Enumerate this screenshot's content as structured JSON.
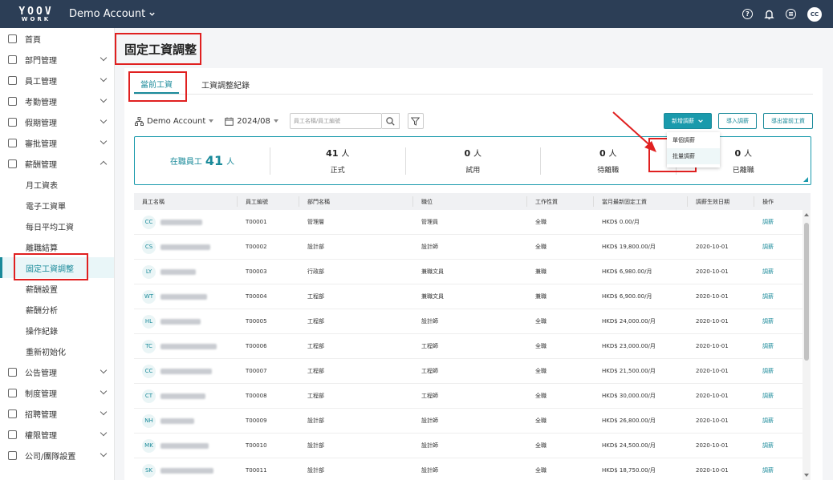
{
  "brand": {
    "line1": "YOOV",
    "line2": "WORK"
  },
  "account": "Demo Account",
  "user_initials": "CC",
  "sidebar": {
    "items": [
      {
        "label": "首頁",
        "icon": "dashboard-icon",
        "chevron": false
      },
      {
        "label": "部門管理",
        "icon": "org-icon",
        "chevron": true
      },
      {
        "label": "員工管理",
        "icon": "users-icon",
        "chevron": true
      },
      {
        "label": "考勤管理",
        "icon": "calendar-icon",
        "chevron": true
      },
      {
        "label": "假期管理",
        "icon": "beach-icon",
        "chevron": true
      },
      {
        "label": "審批管理",
        "icon": "stamp-icon",
        "chevron": true
      },
      {
        "label": "薪酬管理",
        "icon": "dollar-icon",
        "chevron": true,
        "open": true
      }
    ],
    "sub_items": [
      "月工資表",
      "電子工資單",
      "每日平均工資",
      "離職結算",
      "固定工資調整",
      "薪酬設置",
      "薪酬分析",
      "操作紀錄",
      "重新初始化"
    ],
    "items_after": [
      {
        "label": "公告管理",
        "icon": "megaphone-icon"
      },
      {
        "label": "制度管理",
        "icon": "book-icon"
      },
      {
        "label": "招聘管理",
        "icon": "briefcase-icon"
      },
      {
        "label": "權限管理",
        "icon": "shield-icon"
      },
      {
        "label": "公司/團隊設置",
        "icon": "building-icon"
      }
    ]
  },
  "page_title": "固定工資調整",
  "tabs": [
    "當前工資",
    "工資調整紀錄"
  ],
  "filters": {
    "department": "Demo Account",
    "month": "2024/08",
    "search_placeholder": "員工名稱/員工編號"
  },
  "buttons": {
    "new_adjust": "新增調薪",
    "import": "導入調薪",
    "export": "導出當前工資"
  },
  "dropdown": [
    "單個調薪",
    "批量調薪"
  ],
  "stats": {
    "active_label": "在職員工",
    "active_count": "41",
    "active_unit": "人",
    "items": [
      {
        "count": "41",
        "unit": "人",
        "label": "正式"
      },
      {
        "count": "0",
        "unit": "人",
        "label": "試用"
      },
      {
        "count": "0",
        "unit": "人",
        "label": "待離職"
      },
      {
        "count": "0",
        "unit": "人",
        "label": "已離職"
      }
    ]
  },
  "table": {
    "headers": [
      "員工名稱",
      "員工編號",
      "部門名稱",
      "職位",
      "工作性質",
      "當月最新固定工資",
      "調薪生效日期",
      "操作"
    ],
    "rows": [
      {
        "initials": "CC",
        "id": "T00001",
        "dept": "管理層",
        "pos": "管理員",
        "type": "全職",
        "salary": "HKD$ 0.00/月",
        "date": "",
        "action": "調薪"
      },
      {
        "initials": "CS",
        "id": "T00002",
        "dept": "設計部",
        "pos": "設計師",
        "type": "全職",
        "salary": "HKD$ 19,800.00/月",
        "date": "2020-10-01",
        "action": "調薪"
      },
      {
        "initials": "LY",
        "id": "T00003",
        "dept": "行政部",
        "pos": "兼職文員",
        "type": "兼職",
        "salary": "HKD$ 6,980.00/月",
        "date": "2020-10-01",
        "action": "調薪"
      },
      {
        "initials": "WT",
        "id": "T00004",
        "dept": "工程部",
        "pos": "兼職文員",
        "type": "兼職",
        "salary": "HKD$ 6,900.00/月",
        "date": "2020-10-01",
        "action": "調薪"
      },
      {
        "initials": "HL",
        "id": "T00005",
        "dept": "工程部",
        "pos": "設計師",
        "type": "全職",
        "salary": "HKD$ 24,000.00/月",
        "date": "2020-10-01",
        "action": "調薪"
      },
      {
        "initials": "TC",
        "id": "T00006",
        "dept": "工程部",
        "pos": "工程師",
        "type": "全職",
        "salary": "HKD$ 23,000.00/月",
        "date": "2020-10-01",
        "action": "調薪"
      },
      {
        "initials": "CC",
        "id": "T00007",
        "dept": "工程部",
        "pos": "工程師",
        "type": "全職",
        "salary": "HKD$ 21,500.00/月",
        "date": "2020-10-01",
        "action": "調薪"
      },
      {
        "initials": "CT",
        "id": "T00008",
        "dept": "工程部",
        "pos": "工程師",
        "type": "全職",
        "salary": "HKD$ 30,000.00/月",
        "date": "2020-10-01",
        "action": "調薪"
      },
      {
        "initials": "NH",
        "id": "T00009",
        "dept": "設計部",
        "pos": "設計師",
        "type": "全職",
        "salary": "HKD$ 26,800.00/月",
        "date": "2020-10-01",
        "action": "調薪"
      },
      {
        "initials": "MK",
        "id": "T00010",
        "dept": "設計部",
        "pos": "設計師",
        "type": "全職",
        "salary": "HKD$ 24,500.00/月",
        "date": "2020-10-01",
        "action": "調薪"
      },
      {
        "initials": "SK",
        "id": "T00011",
        "dept": "設計部",
        "pos": "設計師",
        "type": "全職",
        "salary": "HKD$ 18,750.00/月",
        "date": "2020-10-01",
        "action": "調薪"
      }
    ]
  },
  "colors": {
    "topbar": "#2c3e56",
    "accent": "#1a8a9a",
    "annotation": "#e02020"
  }
}
